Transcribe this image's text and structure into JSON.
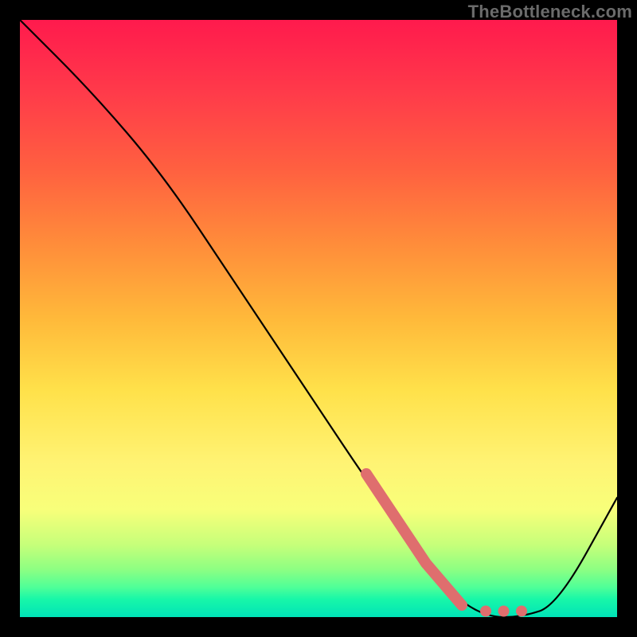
{
  "watermark": "TheBottleneck.com",
  "chart_data": {
    "type": "line",
    "title": "",
    "xlabel": "",
    "ylabel": "",
    "xlim": [
      0,
      100
    ],
    "ylim": [
      0,
      100
    ],
    "grid": false,
    "legend": false,
    "series": [
      {
        "name": "bottleneck-curve",
        "color": "#000000",
        "x": [
          0,
          12,
          24,
          36,
          48,
          60,
          72,
          78,
          84,
          90,
          100
        ],
        "y": [
          100,
          88,
          74,
          56,
          38,
          20,
          4,
          0,
          0,
          2,
          20
        ]
      }
    ],
    "highlight": {
      "name": "highlight-segment",
      "color": "#e07070",
      "points_x": [
        58,
        68,
        74,
        78,
        81,
        84
      ],
      "points_y": [
        24,
        9,
        2,
        1,
        1,
        1
      ]
    },
    "background_gradient": {
      "top": "#ff1a4d",
      "mid": "#ffe14a",
      "bottom": "#00e3b8"
    }
  }
}
